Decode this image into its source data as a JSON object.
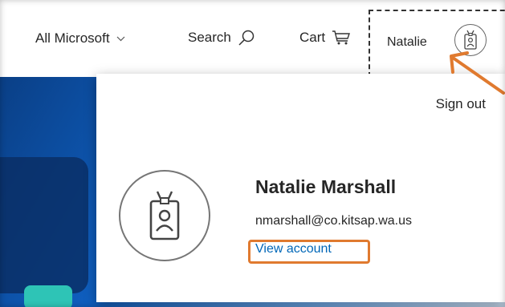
{
  "header": {
    "all_microsoft_label": "All Microsoft",
    "search_label": "Search",
    "cart_label": "Cart",
    "user_short_name": "Natalie"
  },
  "account_panel": {
    "sign_out_label": "Sign out",
    "full_name": "Natalie Marshall",
    "email": "nmarshall@co.kitsap.wa.us",
    "view_account_label": "View account"
  },
  "annotation": {
    "accent_color": "#e07a2f"
  },
  "icons": {
    "chevron": "chevron-down-icon",
    "search": "search-icon",
    "cart": "cart-icon",
    "avatar": "id-badge-icon"
  }
}
